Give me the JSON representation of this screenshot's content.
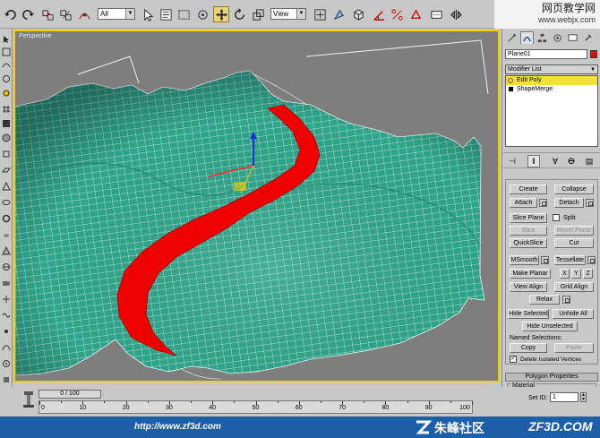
{
  "toolbar": {
    "selection_filter": "All",
    "reference_coord": "View"
  },
  "watermark_top": {
    "line1": "网页教学网",
    "line2": "www.webjx.com"
  },
  "viewport": {
    "label": "Perspective"
  },
  "command_panel": {
    "object_name": "Plane01",
    "object_color": "#d11414",
    "modifier_list": "Modifier List",
    "stack": [
      {
        "label": "Edit Poly",
        "active": true
      },
      {
        "label": "ShapeMerge",
        "active": false
      }
    ],
    "buttons": {
      "create": "Create",
      "collapse": "Collapse",
      "attach": "Attach",
      "detach": "Detach",
      "slice_plane": "Slice Plane",
      "split": "Split",
      "slice": "Slice",
      "reset_plane": "Reset Plane",
      "quickslice": "QuickSlice",
      "cut": "Cut",
      "msmooth": "MSmooth",
      "tessellate": "Tessellate",
      "make_planar": "Make Planar",
      "x": "X",
      "y": "Y",
      "z": "Z",
      "view_align": "View Align",
      "grid_align": "Grid Align",
      "relax": "Relax",
      "hide_selected": "Hide Selected",
      "unhide_all": "Unhide All",
      "hide_unselected": "Hide Unselected",
      "copy": "Copy",
      "paste": "Paste"
    },
    "named_selections_label": "Named Selections:",
    "delete_isolated": "Delete Isolated Vertices",
    "polygon_properties": "Polygon Properties",
    "material_label": "Material",
    "set_id_label": "Set ID:",
    "set_id_value": "1"
  },
  "timeline": {
    "slider_text": "0 / 100",
    "ticks": [
      "0",
      "10",
      "20",
      "30",
      "40",
      "50",
      "60",
      "70",
      "80",
      "90",
      "100"
    ]
  },
  "bottom_bar": {
    "url": "http://www.zf3d.com",
    "brand_cn": "朱峰社区",
    "brand_en": "ZF3D.COM"
  },
  "colors": {
    "terrain": "#2fa58c",
    "road": "#ee0000",
    "viewport_border": "#f1d000",
    "active_stack": "#f0e038"
  }
}
